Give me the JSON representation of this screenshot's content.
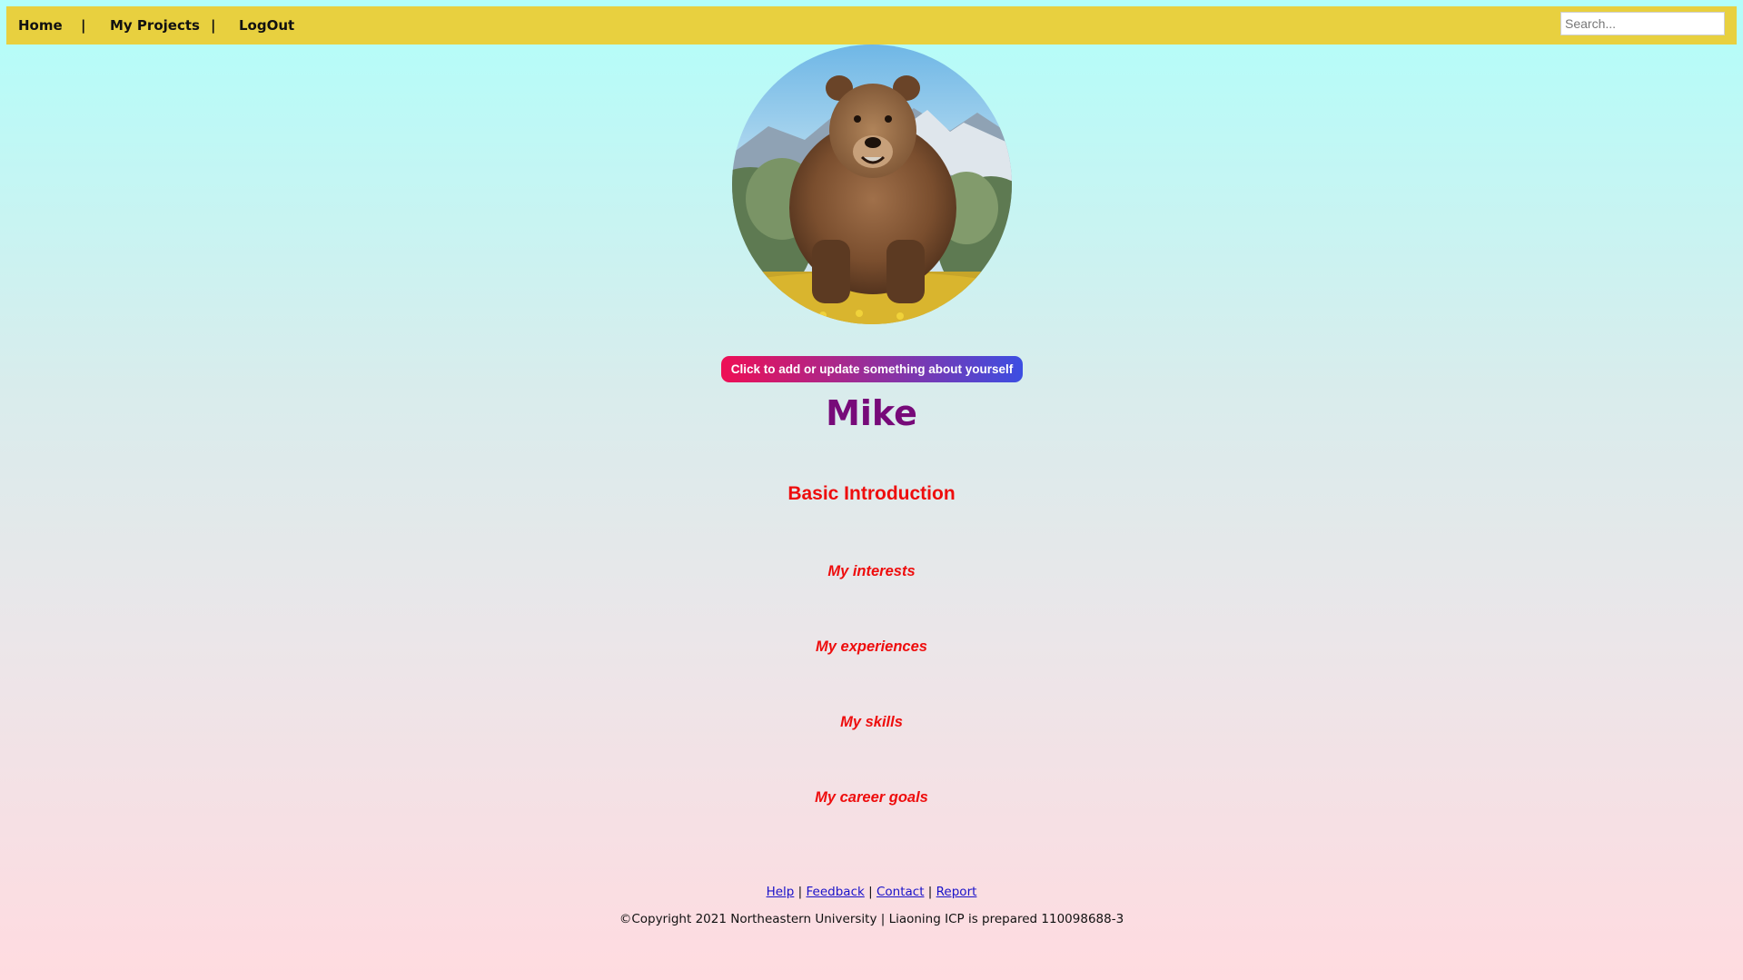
{
  "nav": {
    "links": [
      "Home",
      "My Projects",
      "LogOut"
    ],
    "separator": "|",
    "search_placeholder": "Search..."
  },
  "profile": {
    "update_button": "Click to add or update something about yourself",
    "name": "Mike",
    "avatar_subject": "brown bear"
  },
  "sections": {
    "heading": "Basic Introduction",
    "items": [
      "My interests",
      "My experiences",
      "My skills",
      "My career goals"
    ]
  },
  "footer": {
    "links": [
      "Help",
      "Feedback",
      "Contact",
      "Report"
    ],
    "separator": "|",
    "copyright": "©Copyright 2021 Northeastern University | Liaoning ICP is prepared 110098688-3"
  },
  "colors": {
    "navbar": "#e8d03f",
    "name": "#770a79",
    "headings": "#ee0d0d",
    "button_start": "#ee0f55",
    "button_end": "#3c4ee2",
    "footer_link": "#1a12c9"
  }
}
